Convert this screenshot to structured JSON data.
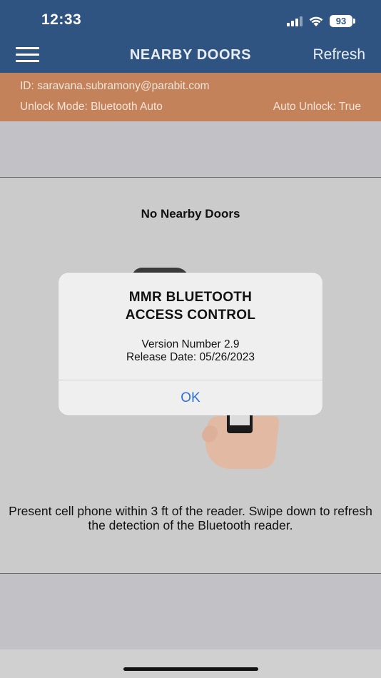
{
  "status_bar": {
    "time": "12:33",
    "battery": "93",
    "icons": [
      "cellular-signal-icon",
      "wifi-icon",
      "battery-icon"
    ]
  },
  "header": {
    "title": "NEARBY DOORS",
    "refresh_label": "Refresh",
    "menu_icon": "hamburger-menu-icon"
  },
  "info": {
    "id": "ID: saravana.subramony@parabit.com",
    "unlock_mode": "Unlock Mode: Bluetooth Auto",
    "auto_unlock": "Auto Unlock: True"
  },
  "main": {
    "heading": "No Nearby Doors",
    "instructions": "Present cell phone within 3 ft of the reader. Swipe down to refresh the detection of the Bluetooth reader."
  },
  "alert": {
    "title_line1": "MMR BLUETOOTH",
    "title_line2": "ACCESS CONTROL",
    "version": "Version Number 2.9",
    "release_date": "Release Date: 05/26/2023",
    "ok_label": "OK"
  },
  "colors": {
    "header_bg": "#2f5482",
    "infobar_bg": "#c3825a",
    "alert_button": "#2f6fd8"
  }
}
